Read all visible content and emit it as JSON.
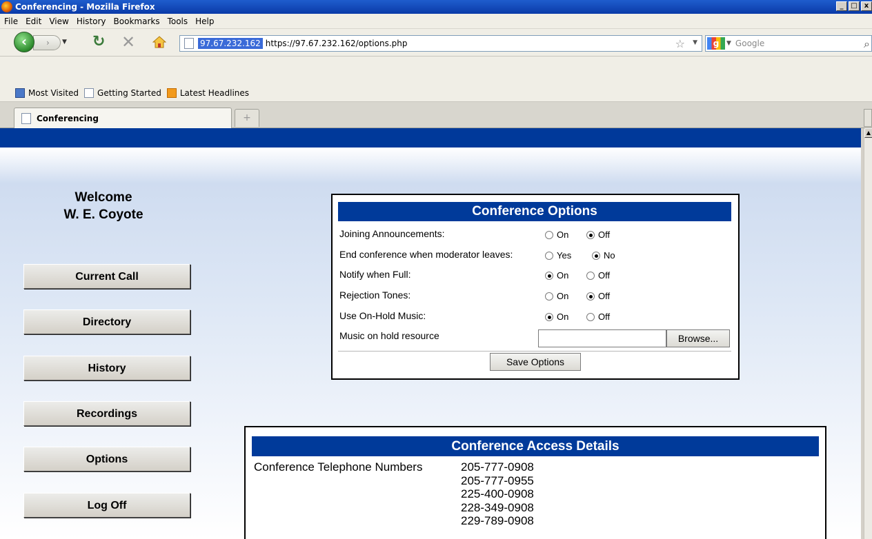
{
  "window": {
    "title": "Conferencing - Mozilla Firefox",
    "min": "_",
    "max": "□",
    "close": "x"
  },
  "menu": [
    "File",
    "Edit",
    "View",
    "History",
    "Bookmarks",
    "Tools",
    "Help"
  ],
  "nav": {
    "site_identity": "97.67.232.162",
    "url": "https://97.67.232.162/options.php",
    "search_placeholder": "Google"
  },
  "bookmarks": [
    "Most Visited",
    "Getting Started",
    "Latest Headlines"
  ],
  "tab": {
    "label": "Conferencing",
    "new_tab": "+"
  },
  "welcome": {
    "line1": "Welcome",
    "line2": "W. E. Coyote"
  },
  "sidebar": {
    "items": [
      {
        "label": "Current Call"
      },
      {
        "label": "Directory"
      },
      {
        "label": "History"
      },
      {
        "label": "Recordings"
      },
      {
        "label": "Options"
      },
      {
        "label": "Log Off"
      }
    ]
  },
  "options": {
    "title": "Conference Options",
    "rows": [
      {
        "label": "Joining Announcements:",
        "choices": [
          "On",
          "Off"
        ],
        "selected": "Off"
      },
      {
        "label": "End conference when moderator leaves:",
        "choices": [
          "Yes",
          "No"
        ],
        "selected": "No"
      },
      {
        "label": "Notify when Full:",
        "choices": [
          "On",
          "Off"
        ],
        "selected": "On"
      },
      {
        "label": "Rejection Tones:",
        "choices": [
          "On",
          "Off"
        ],
        "selected": "Off"
      },
      {
        "label": "Use On-Hold Music:",
        "choices": [
          "On",
          "Off"
        ],
        "selected": "On"
      }
    ],
    "music_label": "Music on hold resource",
    "browse_label": "Browse...",
    "save_label": "Save Options"
  },
  "access": {
    "title": "Conference Access Details",
    "numbers_label": "Conference Telephone Numbers",
    "numbers": [
      "205-777-0908",
      "205-777-0955",
      "225-400-0908",
      "228-349-0908",
      "229-789-0908"
    ]
  },
  "colors": {
    "header_blue": "#003a9a",
    "top_stripe": "#00399a"
  }
}
